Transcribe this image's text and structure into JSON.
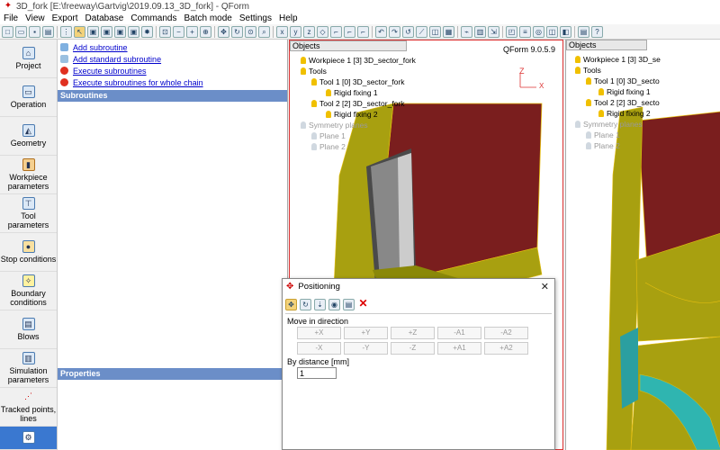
{
  "window": {
    "title": "3D_fork  [E:\\freeway\\Gartvig\\2019.09.13_3D_fork] - QForm"
  },
  "menu": [
    "File",
    "View",
    "Export",
    "Database",
    "Commands",
    "Batch mode",
    "Settings",
    "Help"
  ],
  "sidebar": {
    "items": [
      {
        "label": "Project",
        "icon": "project-icon"
      },
      {
        "label": "Operation",
        "icon": "operation-icon"
      },
      {
        "label": "Geometry",
        "icon": "geometry-icon"
      },
      {
        "label": "Workpiece parameters",
        "icon": "workpiece-icon"
      },
      {
        "label": "Tool parameters",
        "icon": "tool-icon"
      },
      {
        "label": "Stop conditions",
        "icon": "stop-conditions-icon"
      },
      {
        "label": "Boundary conditions",
        "icon": "boundary-icon"
      },
      {
        "label": "Blows",
        "icon": "blows-icon"
      },
      {
        "label": "Simulation parameters",
        "icon": "simulation-icon"
      },
      {
        "label": "Tracked points, lines",
        "icon": "tracked-points-icon"
      },
      {
        "label": "",
        "icon": "subroutines-icon"
      }
    ]
  },
  "subroutine_panel": {
    "links": [
      {
        "label": "Add subroutine"
      },
      {
        "label": "Add standard subroutine"
      },
      {
        "label": "Execute subroutines"
      },
      {
        "label": "Execute subroutines for whole chain"
      }
    ],
    "subroutines_header": "Subroutines",
    "properties_header": "Properties"
  },
  "viewport": {
    "objects_header": "Objects",
    "version": "QForm 9.0.5.9",
    "tree": [
      {
        "label": "Workpiece 1 [3] 3D_sector_fork"
      },
      {
        "label": "Tools"
      },
      {
        "label": "Tool 1 [0] 3D_sector_fork"
      },
      {
        "label": "Rigid fixing 1"
      },
      {
        "label": "Tool 2 [2] 3D_sector_fork"
      },
      {
        "label": "Rigid fixing 2"
      },
      {
        "label": "Symmetry planes"
      },
      {
        "label": "Plane 1"
      },
      {
        "label": "Plane 2"
      }
    ],
    "tree_right": [
      {
        "label": "Workpiece 1 [3] 3D_se"
      },
      {
        "label": "Tools"
      },
      {
        "label": "Tool 1 [0] 3D_secto"
      },
      {
        "label": "Rigid fixing 1"
      },
      {
        "label": "Tool 2 [2] 3D_secto"
      },
      {
        "label": "Rigid fixing 2"
      },
      {
        "label": "Symmetry planes"
      },
      {
        "label": "Plane 1"
      },
      {
        "label": "Plane 2"
      }
    ],
    "axis_z": "Z",
    "axis_x": "X"
  },
  "dialog": {
    "title": "Positioning",
    "move_label": "Move in direction",
    "buttons_row1": [
      "+X",
      "+Y",
      "+Z",
      "-A1",
      "-A2"
    ],
    "buttons_row2": [
      "-X",
      "-Y",
      "-Z",
      "+A1",
      "+A2"
    ],
    "distance_label": "By distance [mm]",
    "distance_value": "1"
  },
  "colors": {
    "workpiece_red": "#7a1e1e",
    "tool_yellow": "#a8a010",
    "highlight": "#d33333",
    "active_nav": "#3a78d0"
  }
}
